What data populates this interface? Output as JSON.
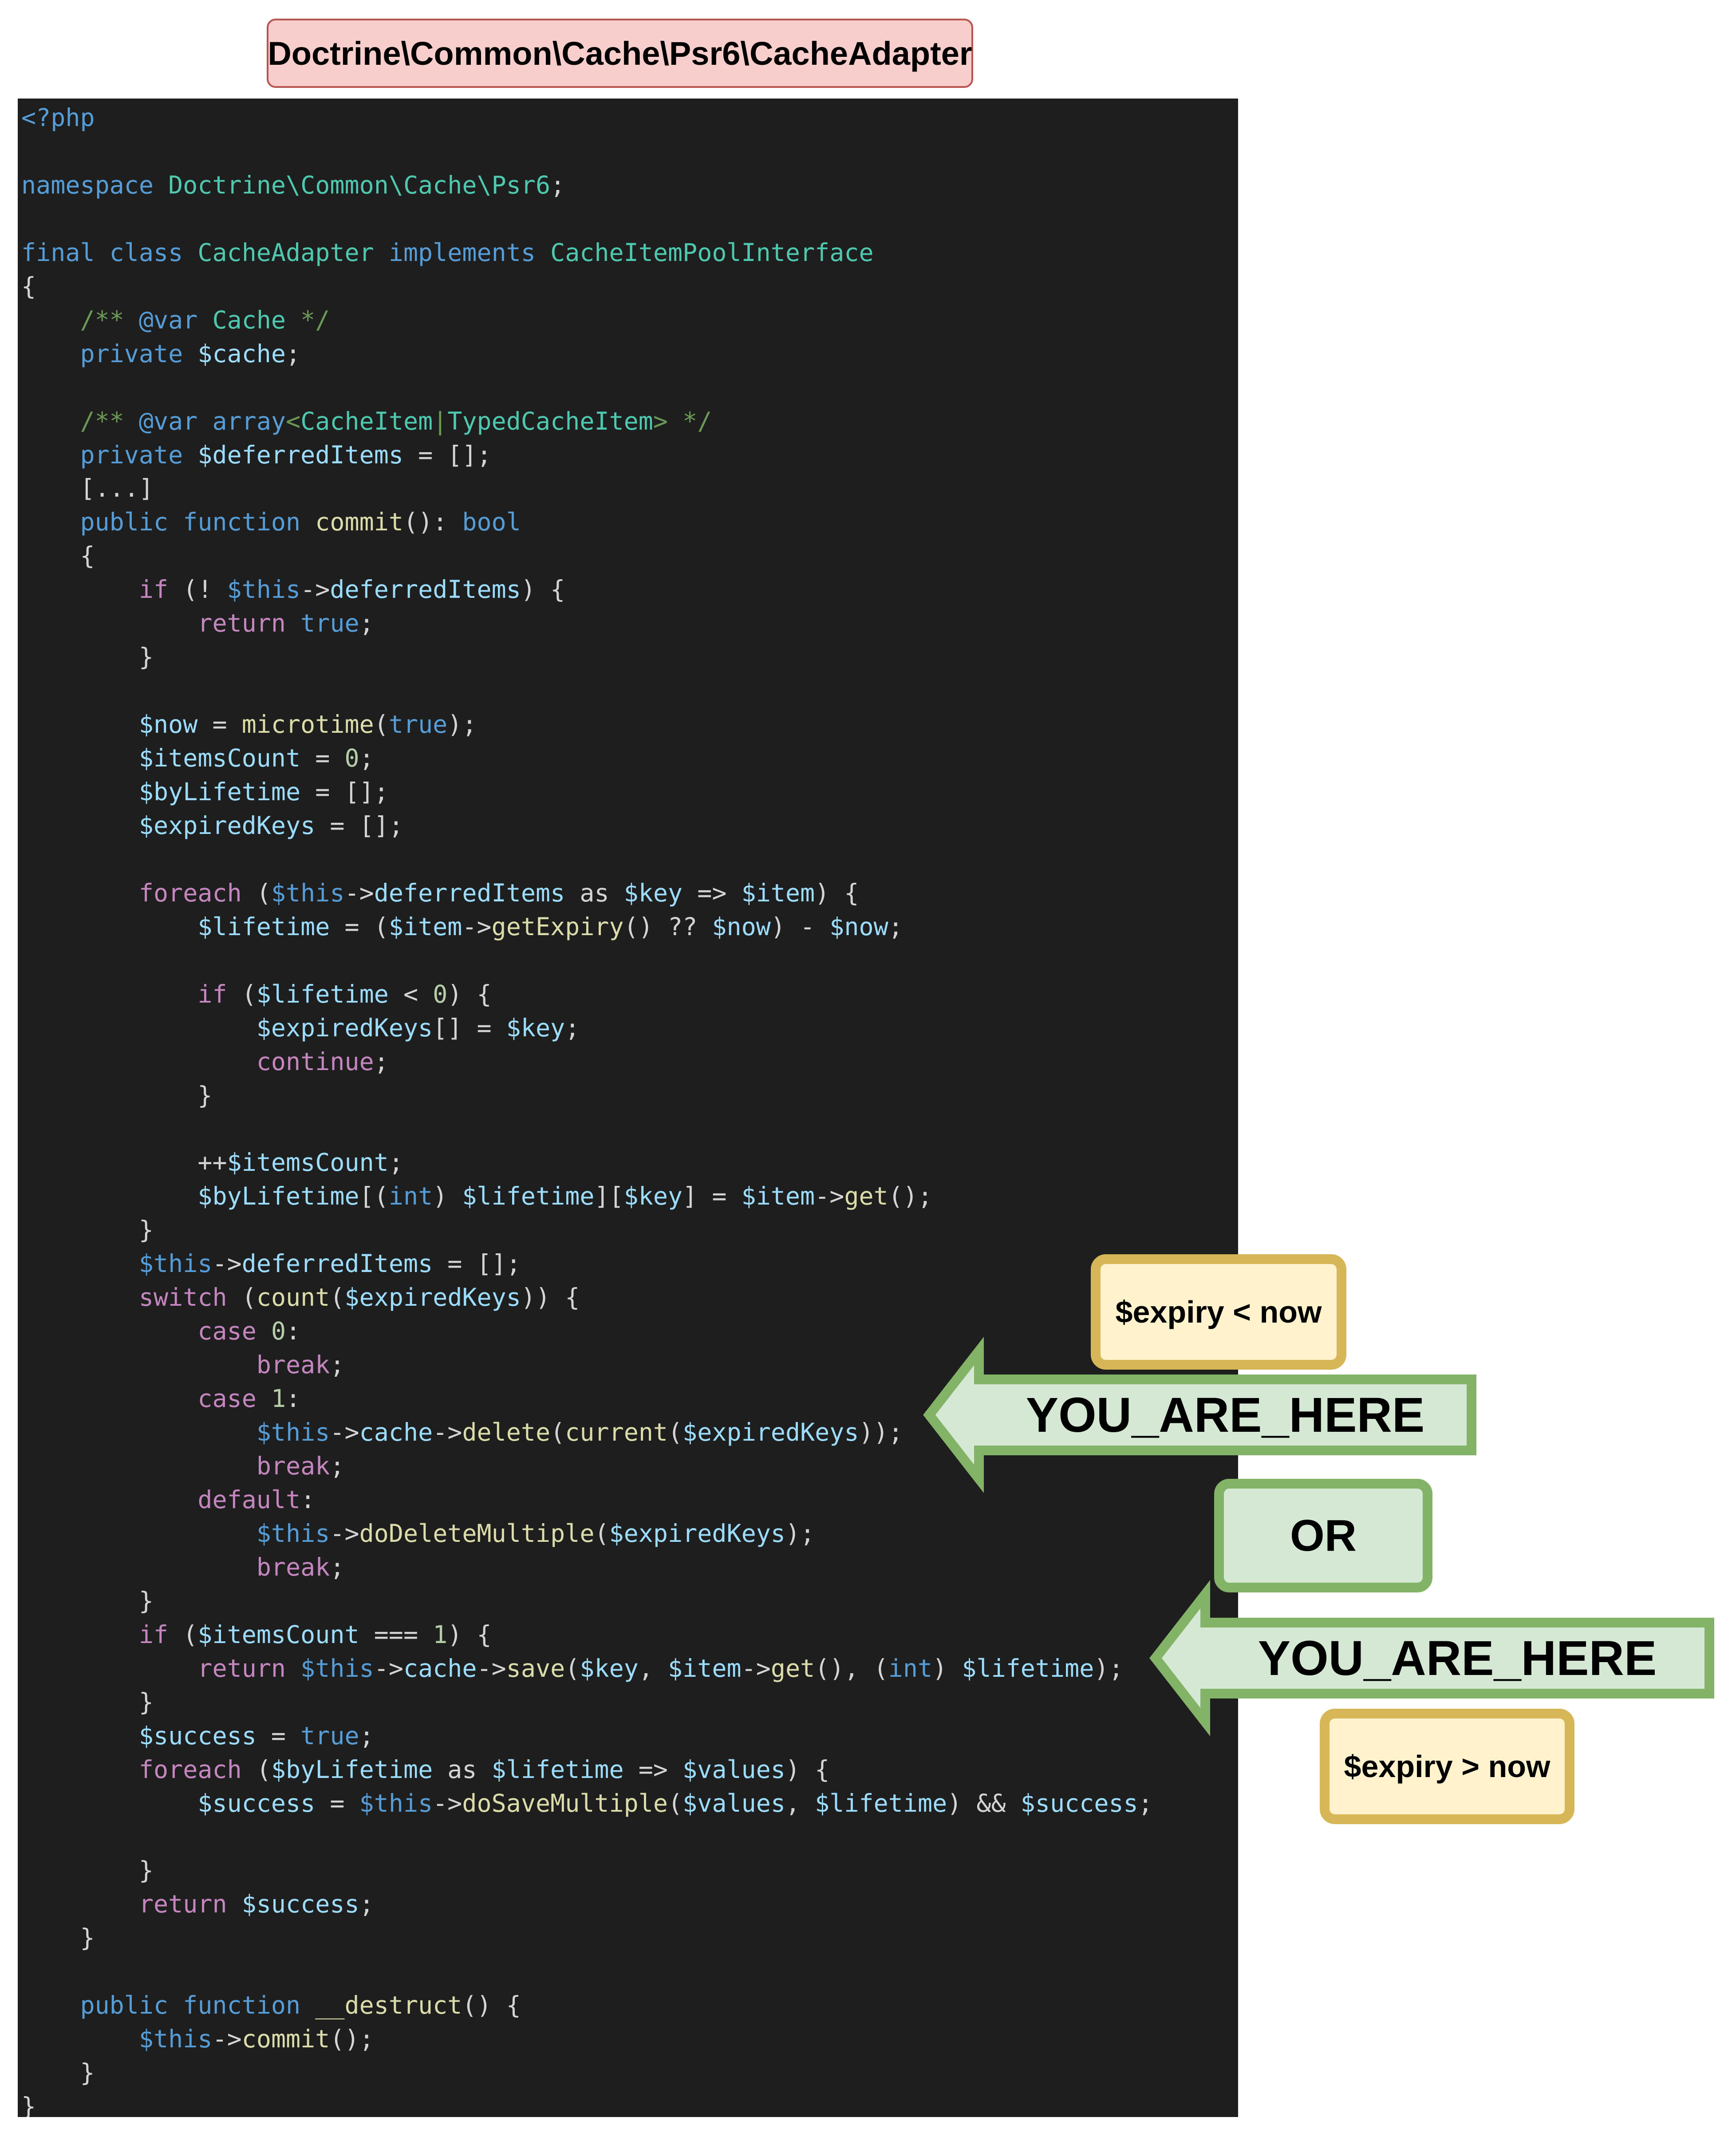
{
  "title": "Doctrine\\Common\\Cache\\Psr6\\CacheAdapter",
  "code_lines": [
    [
      [
        "kw",
        "<?php"
      ]
    ],
    [],
    [
      [
        "kw",
        "namespace "
      ],
      [
        "ty",
        "Doctrine\\Common\\Cache\\Psr6"
      ],
      [
        "pl",
        ";"
      ]
    ],
    [],
    [
      [
        "kw",
        "final class "
      ],
      [
        "ty",
        "CacheAdapter "
      ],
      [
        "kw",
        "implements "
      ],
      [
        "ty",
        "CacheItemPoolInterface"
      ]
    ],
    [
      [
        "pl",
        "{"
      ]
    ],
    [
      [
        "pl",
        "    "
      ],
      [
        "cm",
        "/** "
      ],
      [
        "kw",
        "@var "
      ],
      [
        "ty",
        "Cache "
      ],
      [
        "cm",
        "*/"
      ]
    ],
    [
      [
        "pl",
        "    "
      ],
      [
        "kw",
        "private "
      ],
      [
        "var",
        "$cache"
      ],
      [
        "pl",
        ";"
      ]
    ],
    [],
    [
      [
        "pl",
        "    "
      ],
      [
        "cm",
        "/** "
      ],
      [
        "kw",
        "@var "
      ],
      [
        "kw",
        "array"
      ],
      [
        "cm",
        "<"
      ],
      [
        "ty",
        "CacheItem"
      ],
      [
        "cm",
        "|"
      ],
      [
        "ty",
        "TypedCacheItem"
      ],
      [
        "cm",
        "> */"
      ]
    ],
    [
      [
        "pl",
        "    "
      ],
      [
        "kw",
        "private "
      ],
      [
        "var",
        "$deferredItems"
      ],
      [
        "pl",
        " = [];"
      ]
    ],
    [
      [
        "pl",
        "    [...]"
      ]
    ],
    [
      [
        "pl",
        "    "
      ],
      [
        "kw",
        "public function "
      ],
      [
        "fn",
        "commit"
      ],
      [
        "pl",
        "(): "
      ],
      [
        "kw",
        "bool"
      ]
    ],
    [
      [
        "pl",
        "    {"
      ]
    ],
    [
      [
        "pl",
        "        "
      ],
      [
        "ctl",
        "if "
      ],
      [
        "pl",
        "(! "
      ],
      [
        "kw",
        "$this"
      ],
      [
        "pl",
        "->"
      ],
      [
        "var",
        "deferredItems"
      ],
      [
        "pl",
        ") {"
      ]
    ],
    [
      [
        "pl",
        "            "
      ],
      [
        "ctl",
        "return "
      ],
      [
        "kw",
        "true"
      ],
      [
        "pl",
        ";"
      ]
    ],
    [
      [
        "pl",
        "        }"
      ]
    ],
    [],
    [
      [
        "pl",
        "        "
      ],
      [
        "var",
        "$now"
      ],
      [
        "pl",
        " = "
      ],
      [
        "fn",
        "microtime"
      ],
      [
        "pl",
        "("
      ],
      [
        "kw",
        "true"
      ],
      [
        "pl",
        ");"
      ]
    ],
    [
      [
        "pl",
        "        "
      ],
      [
        "var",
        "$itemsCount"
      ],
      [
        "pl",
        " = "
      ],
      [
        "num",
        "0"
      ],
      [
        "pl",
        ";"
      ]
    ],
    [
      [
        "pl",
        "        "
      ],
      [
        "var",
        "$byLifetime"
      ],
      [
        "pl",
        " = [];"
      ]
    ],
    [
      [
        "pl",
        "        "
      ],
      [
        "var",
        "$expiredKeys"
      ],
      [
        "pl",
        " = [];"
      ]
    ],
    [],
    [
      [
        "pl",
        "        "
      ],
      [
        "ctl",
        "foreach "
      ],
      [
        "pl",
        "("
      ],
      [
        "kw",
        "$this"
      ],
      [
        "pl",
        "->"
      ],
      [
        "var",
        "deferredItems"
      ],
      [
        "pl",
        " as "
      ],
      [
        "var",
        "$key"
      ],
      [
        "pl",
        " => "
      ],
      [
        "var",
        "$item"
      ],
      [
        "pl",
        ") {"
      ]
    ],
    [
      [
        "pl",
        "            "
      ],
      [
        "var",
        "$lifetime"
      ],
      [
        "pl",
        " = ("
      ],
      [
        "var",
        "$item"
      ],
      [
        "pl",
        "->"
      ],
      [
        "fn",
        "getExpiry"
      ],
      [
        "pl",
        "() ?? "
      ],
      [
        "var",
        "$now"
      ],
      [
        "pl",
        ") - "
      ],
      [
        "var",
        "$now"
      ],
      [
        "pl",
        ";"
      ]
    ],
    [],
    [
      [
        "pl",
        "            "
      ],
      [
        "ctl",
        "if "
      ],
      [
        "pl",
        "("
      ],
      [
        "var",
        "$lifetime"
      ],
      [
        "pl",
        " < "
      ],
      [
        "num",
        "0"
      ],
      [
        "pl",
        ") {"
      ]
    ],
    [
      [
        "pl",
        "                "
      ],
      [
        "var",
        "$expiredKeys"
      ],
      [
        "pl",
        "[] = "
      ],
      [
        "var",
        "$key"
      ],
      [
        "pl",
        ";"
      ]
    ],
    [
      [
        "pl",
        "                "
      ],
      [
        "ctl",
        "continue"
      ],
      [
        "pl",
        ";"
      ]
    ],
    [
      [
        "pl",
        "            }"
      ]
    ],
    [],
    [
      [
        "pl",
        "            ++"
      ],
      [
        "var",
        "$itemsCount"
      ],
      [
        "pl",
        ";"
      ]
    ],
    [
      [
        "pl",
        "            "
      ],
      [
        "var",
        "$byLifetime"
      ],
      [
        "pl",
        "[("
      ],
      [
        "kw",
        "int"
      ],
      [
        "pl",
        ") "
      ],
      [
        "var",
        "$lifetime"
      ],
      [
        "pl",
        "]["
      ],
      [
        "var",
        "$key"
      ],
      [
        "pl",
        "] = "
      ],
      [
        "var",
        "$item"
      ],
      [
        "pl",
        "->"
      ],
      [
        "fn",
        "get"
      ],
      [
        "pl",
        "();"
      ]
    ],
    [
      [
        "pl",
        "        }"
      ]
    ],
    [
      [
        "pl",
        "        "
      ],
      [
        "kw",
        "$this"
      ],
      [
        "pl",
        "->"
      ],
      [
        "var",
        "deferredItems"
      ],
      [
        "pl",
        " = [];"
      ]
    ],
    [
      [
        "pl",
        "        "
      ],
      [
        "ctl",
        "switch "
      ],
      [
        "pl",
        "("
      ],
      [
        "fn",
        "count"
      ],
      [
        "pl",
        "("
      ],
      [
        "var",
        "$expiredKeys"
      ],
      [
        "pl",
        ")) {"
      ]
    ],
    [
      [
        "pl",
        "            "
      ],
      [
        "ctl",
        "case "
      ],
      [
        "num",
        "0"
      ],
      [
        "pl",
        ":"
      ]
    ],
    [
      [
        "pl",
        "                "
      ],
      [
        "ctl",
        "break"
      ],
      [
        "pl",
        ";"
      ]
    ],
    [
      [
        "pl",
        "            "
      ],
      [
        "ctl",
        "case "
      ],
      [
        "num",
        "1"
      ],
      [
        "pl",
        ":"
      ]
    ],
    [
      [
        "pl",
        "                "
      ],
      [
        "kw",
        "$this"
      ],
      [
        "pl",
        "->"
      ],
      [
        "var",
        "cache"
      ],
      [
        "pl",
        "->"
      ],
      [
        "fn",
        "delete"
      ],
      [
        "pl",
        "("
      ],
      [
        "fn",
        "current"
      ],
      [
        "pl",
        "("
      ],
      [
        "var",
        "$expiredKeys"
      ],
      [
        "pl",
        "));"
      ]
    ],
    [
      [
        "pl",
        "                "
      ],
      [
        "ctl",
        "break"
      ],
      [
        "pl",
        ";"
      ]
    ],
    [
      [
        "pl",
        "            "
      ],
      [
        "ctl",
        "default"
      ],
      [
        "pl",
        ":"
      ]
    ],
    [
      [
        "pl",
        "                "
      ],
      [
        "kw",
        "$this"
      ],
      [
        "pl",
        "->"
      ],
      [
        "fn",
        "doDeleteMultiple"
      ],
      [
        "pl",
        "("
      ],
      [
        "var",
        "$expiredKeys"
      ],
      [
        "pl",
        ");"
      ]
    ],
    [
      [
        "pl",
        "                "
      ],
      [
        "ctl",
        "break"
      ],
      [
        "pl",
        ";"
      ]
    ],
    [
      [
        "pl",
        "        }"
      ]
    ],
    [
      [
        "pl",
        "        "
      ],
      [
        "ctl",
        "if "
      ],
      [
        "pl",
        "("
      ],
      [
        "var",
        "$itemsCount"
      ],
      [
        "pl",
        " === "
      ],
      [
        "num",
        "1"
      ],
      [
        "pl",
        ") {"
      ]
    ],
    [
      [
        "pl",
        "            "
      ],
      [
        "ctl",
        "return "
      ],
      [
        "kw",
        "$this"
      ],
      [
        "pl",
        "->"
      ],
      [
        "var",
        "cache"
      ],
      [
        "pl",
        "->"
      ],
      [
        "fn",
        "save"
      ],
      [
        "pl",
        "("
      ],
      [
        "var",
        "$key"
      ],
      [
        "pl",
        ", "
      ],
      [
        "var",
        "$item"
      ],
      [
        "pl",
        "->"
      ],
      [
        "fn",
        "get"
      ],
      [
        "pl",
        "(), ("
      ],
      [
        "kw",
        "int"
      ],
      [
        "pl",
        ") "
      ],
      [
        "var",
        "$lifetime"
      ],
      [
        "pl",
        ");"
      ]
    ],
    [
      [
        "pl",
        "        }"
      ]
    ],
    [
      [
        "pl",
        "        "
      ],
      [
        "var",
        "$success"
      ],
      [
        "pl",
        " = "
      ],
      [
        "kw",
        "true"
      ],
      [
        "pl",
        ";"
      ]
    ],
    [
      [
        "pl",
        "        "
      ],
      [
        "ctl",
        "foreach "
      ],
      [
        "pl",
        "("
      ],
      [
        "var",
        "$byLifetime"
      ],
      [
        "pl",
        " as "
      ],
      [
        "var",
        "$lifetime"
      ],
      [
        "pl",
        " => "
      ],
      [
        "var",
        "$values"
      ],
      [
        "pl",
        ") {"
      ]
    ],
    [
      [
        "pl",
        "            "
      ],
      [
        "var",
        "$success"
      ],
      [
        "pl",
        " = "
      ],
      [
        "kw",
        "$this"
      ],
      [
        "pl",
        "->"
      ],
      [
        "fn",
        "doSaveMultiple"
      ],
      [
        "pl",
        "("
      ],
      [
        "var",
        "$values"
      ],
      [
        "pl",
        ", "
      ],
      [
        "var",
        "$lifetime"
      ],
      [
        "pl",
        ") && "
      ],
      [
        "var",
        "$success"
      ],
      [
        "pl",
        ";"
      ]
    ],
    [],
    [
      [
        "pl",
        "        }"
      ]
    ],
    [
      [
        "pl",
        "        "
      ],
      [
        "ctl",
        "return "
      ],
      [
        "var",
        "$success"
      ],
      [
        "pl",
        ";"
      ]
    ],
    [
      [
        "pl",
        "    }"
      ]
    ],
    [],
    [
      [
        "pl",
        "    "
      ],
      [
        "kw",
        "public function "
      ],
      [
        "fn",
        "__destruct"
      ],
      [
        "pl",
        "() {"
      ]
    ],
    [
      [
        "pl",
        "        "
      ],
      [
        "kw",
        "$this"
      ],
      [
        "pl",
        "->"
      ],
      [
        "fn",
        "commit"
      ],
      [
        "pl",
        "();"
      ]
    ],
    [
      [
        "pl",
        "    }"
      ]
    ],
    [
      [
        "pl",
        "}"
      ]
    ]
  ],
  "annotations": {
    "expiry_past_label": "$expiry < now",
    "arrow_top_label": "YOU_ARE_HERE",
    "or_label": "OR",
    "arrow_bottom_label": "YOU_ARE_HERE",
    "expiry_future_label": "$expiry > now"
  },
  "colors": {
    "code_background": "#1e1e1e",
    "title_fill": "#f8cecc",
    "title_border": "#b85450",
    "note_fill": "#fff2cc",
    "note_border": "#d6b656",
    "arrow_fill": "#d5e8d4",
    "arrow_border": "#82b366"
  }
}
